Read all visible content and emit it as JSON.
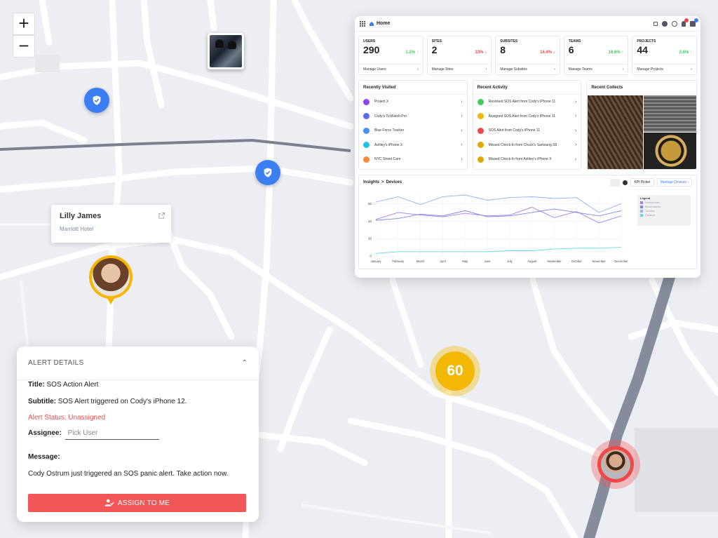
{
  "map": {
    "zoom_in_label": "+",
    "zoom_out_label": "−",
    "person_card": {
      "name": "Lilly James",
      "place": "Marriott Hotel"
    },
    "cluster_count": "60"
  },
  "dashboard": {
    "title": "Home",
    "kpis": [
      {
        "label": "USERS",
        "value": "290",
        "change": "1.2% ↑",
        "trend": "up",
        "link": "Manage Users"
      },
      {
        "label": "SITES",
        "value": "2",
        "change": "33% ↓",
        "trend": "down",
        "link": "Manage Sites"
      },
      {
        "label": "SUBSITES",
        "value": "8",
        "change": "14.4% ↓",
        "trend": "down",
        "link": "Manage Subsites"
      },
      {
        "label": "TEAMS",
        "value": "6",
        "change": "16.6% ↑",
        "trend": "up",
        "link": "Manage Teams"
      },
      {
        "label": "PROJECTS",
        "value": "44",
        "change": "3.6% ↑",
        "trend": "up",
        "link": "Manage Projects"
      }
    ],
    "recently_visited": {
      "title": "Recently Visited",
      "items": [
        {
          "label": "Project X",
          "color": "#8e44ef"
        },
        {
          "label": "Cody's TicWatch Pro",
          "color": "#5b6cf0"
        },
        {
          "label": "Blue Force Tracker",
          "color": "#4a90f2"
        },
        {
          "label": "Ashley's iPhone X",
          "color": "#22c1e8"
        },
        {
          "label": "NYC Street Cam",
          "color": "#f58a3a"
        }
      ]
    },
    "recent_activity": {
      "title": "Recent Activity",
      "items": [
        {
          "label": "Resolved SOS Alert from Cody's iPhone 11",
          "color": "#3ccf5a"
        },
        {
          "label": "Assigned SOS Alert from Cody's iPhone 11",
          "color": "#f3b806"
        },
        {
          "label": "SOS Alert from Cody's iPhone 11",
          "color": "#ef4848"
        },
        {
          "label": "Missed Check-In from Chuck's Samsung S9",
          "color": "#e2a800"
        },
        {
          "label": "Missed Check-In from Ashley's iPhone X",
          "color": "#e2a800"
        }
      ]
    },
    "recent_collects": {
      "title": "Recent Collects"
    },
    "insights": {
      "breadcrumb_root": "Insights",
      "breadcrumb_sep": ">",
      "breadcrumb_page": "Devices",
      "kpi_picker": "KPI Picker",
      "manage_devices": "Manage Devices",
      "legend_title": "Legend",
      "legend_items": [
        "Smartphones",
        "Smartwatches",
        "Trackers",
        "Cameras"
      ]
    },
    "chart_data": {
      "type": "line",
      "categories": [
        "January",
        "February",
        "March",
        "April",
        "May",
        "June",
        "July",
        "August",
        "September",
        "October",
        "November",
        "December"
      ],
      "ylim": [
        0,
        70
      ],
      "yticks": [
        0,
        20,
        40,
        60
      ],
      "grid": true,
      "legend": "right",
      "series": [
        {
          "name": "Smartphones",
          "color": "#a07ef0",
          "values": [
            42,
            50,
            47,
            45,
            49,
            46,
            47,
            56,
            44,
            51,
            38,
            46
          ]
        },
        {
          "name": "Smartwatches",
          "color": "#7b86ec",
          "values": [
            41,
            43,
            48,
            46,
            52,
            45,
            46,
            50,
            54,
            50,
            46,
            52
          ]
        },
        {
          "name": "Trackers",
          "color": "#8fb6f5",
          "values": [
            62,
            68,
            59,
            68,
            70,
            64,
            67,
            68,
            66,
            67,
            50,
            60
          ]
        },
        {
          "name": "Cameras",
          "color": "#5fd8ec",
          "values": [
            3,
            5,
            5,
            5,
            5,
            5,
            6,
            6,
            8,
            9,
            9,
            10
          ]
        }
      ]
    }
  },
  "alert": {
    "heading": "ALERT DETAILS",
    "title_label": "Title:",
    "title_value": "SOS Action Alert",
    "subtitle_label": "Subtitle:",
    "subtitle_value": "SOS Alert triggered on Cody's iPhone 12.",
    "status_label": "Alert Status:",
    "status_value": "Unassigned",
    "assignee_label": "Assignee:",
    "assignee_placeholder": "Pick User",
    "message_label": "Message:",
    "message_value": "Cody Ostrum just triggered an SOS panic alert. Take action now.",
    "assign_button": "ASSIGN TO ME"
  }
}
